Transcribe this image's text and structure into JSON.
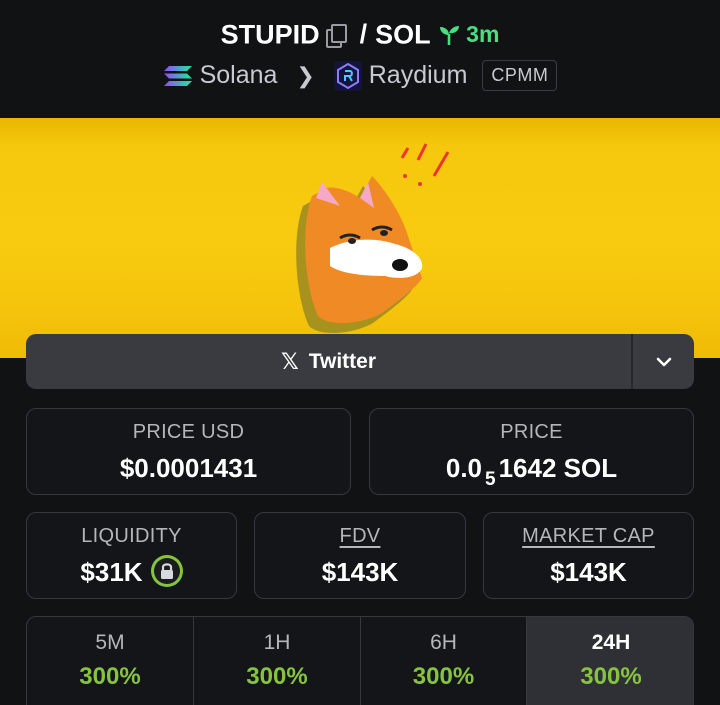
{
  "header": {
    "base_symbol": "STUPID",
    "separator": "/",
    "quote_symbol": "SOL",
    "age": "3m",
    "chain": "Solana",
    "dex": "Raydium",
    "pool_type": "CPMM"
  },
  "socials": {
    "twitter_label": "Twitter"
  },
  "stats": {
    "price_usd_label": "PRICE USD",
    "price_usd_value": "$0.0001431",
    "price_label": "PRICE",
    "price_prefix": "0.0",
    "price_zero_count": "5",
    "price_digits": "1642",
    "price_unit": "SOL",
    "liquidity_label": "LIQUIDITY",
    "liquidity_value": "$31K",
    "fdv_label": "FDV",
    "fdv_value": "$143K",
    "mcap_label": "MARKET CAP",
    "mcap_value": "$143K"
  },
  "timeframes": [
    {
      "label": "5M",
      "value": "300%"
    },
    {
      "label": "1H",
      "value": "300%"
    },
    {
      "label": "6H",
      "value": "300%"
    },
    {
      "label": "24H",
      "value": "300%"
    }
  ],
  "active_timeframe": "24H",
  "icons": [
    "copy-icon",
    "sprout-icon",
    "solana-logo-icon",
    "chevron-right-icon",
    "raydium-logo-icon",
    "x-logo-icon",
    "chevron-down-icon",
    "lock-icon"
  ],
  "colors": {
    "positive": "#86c440",
    "age": "#4ade80",
    "banner": "#f8cb10",
    "background": "#111214"
  }
}
